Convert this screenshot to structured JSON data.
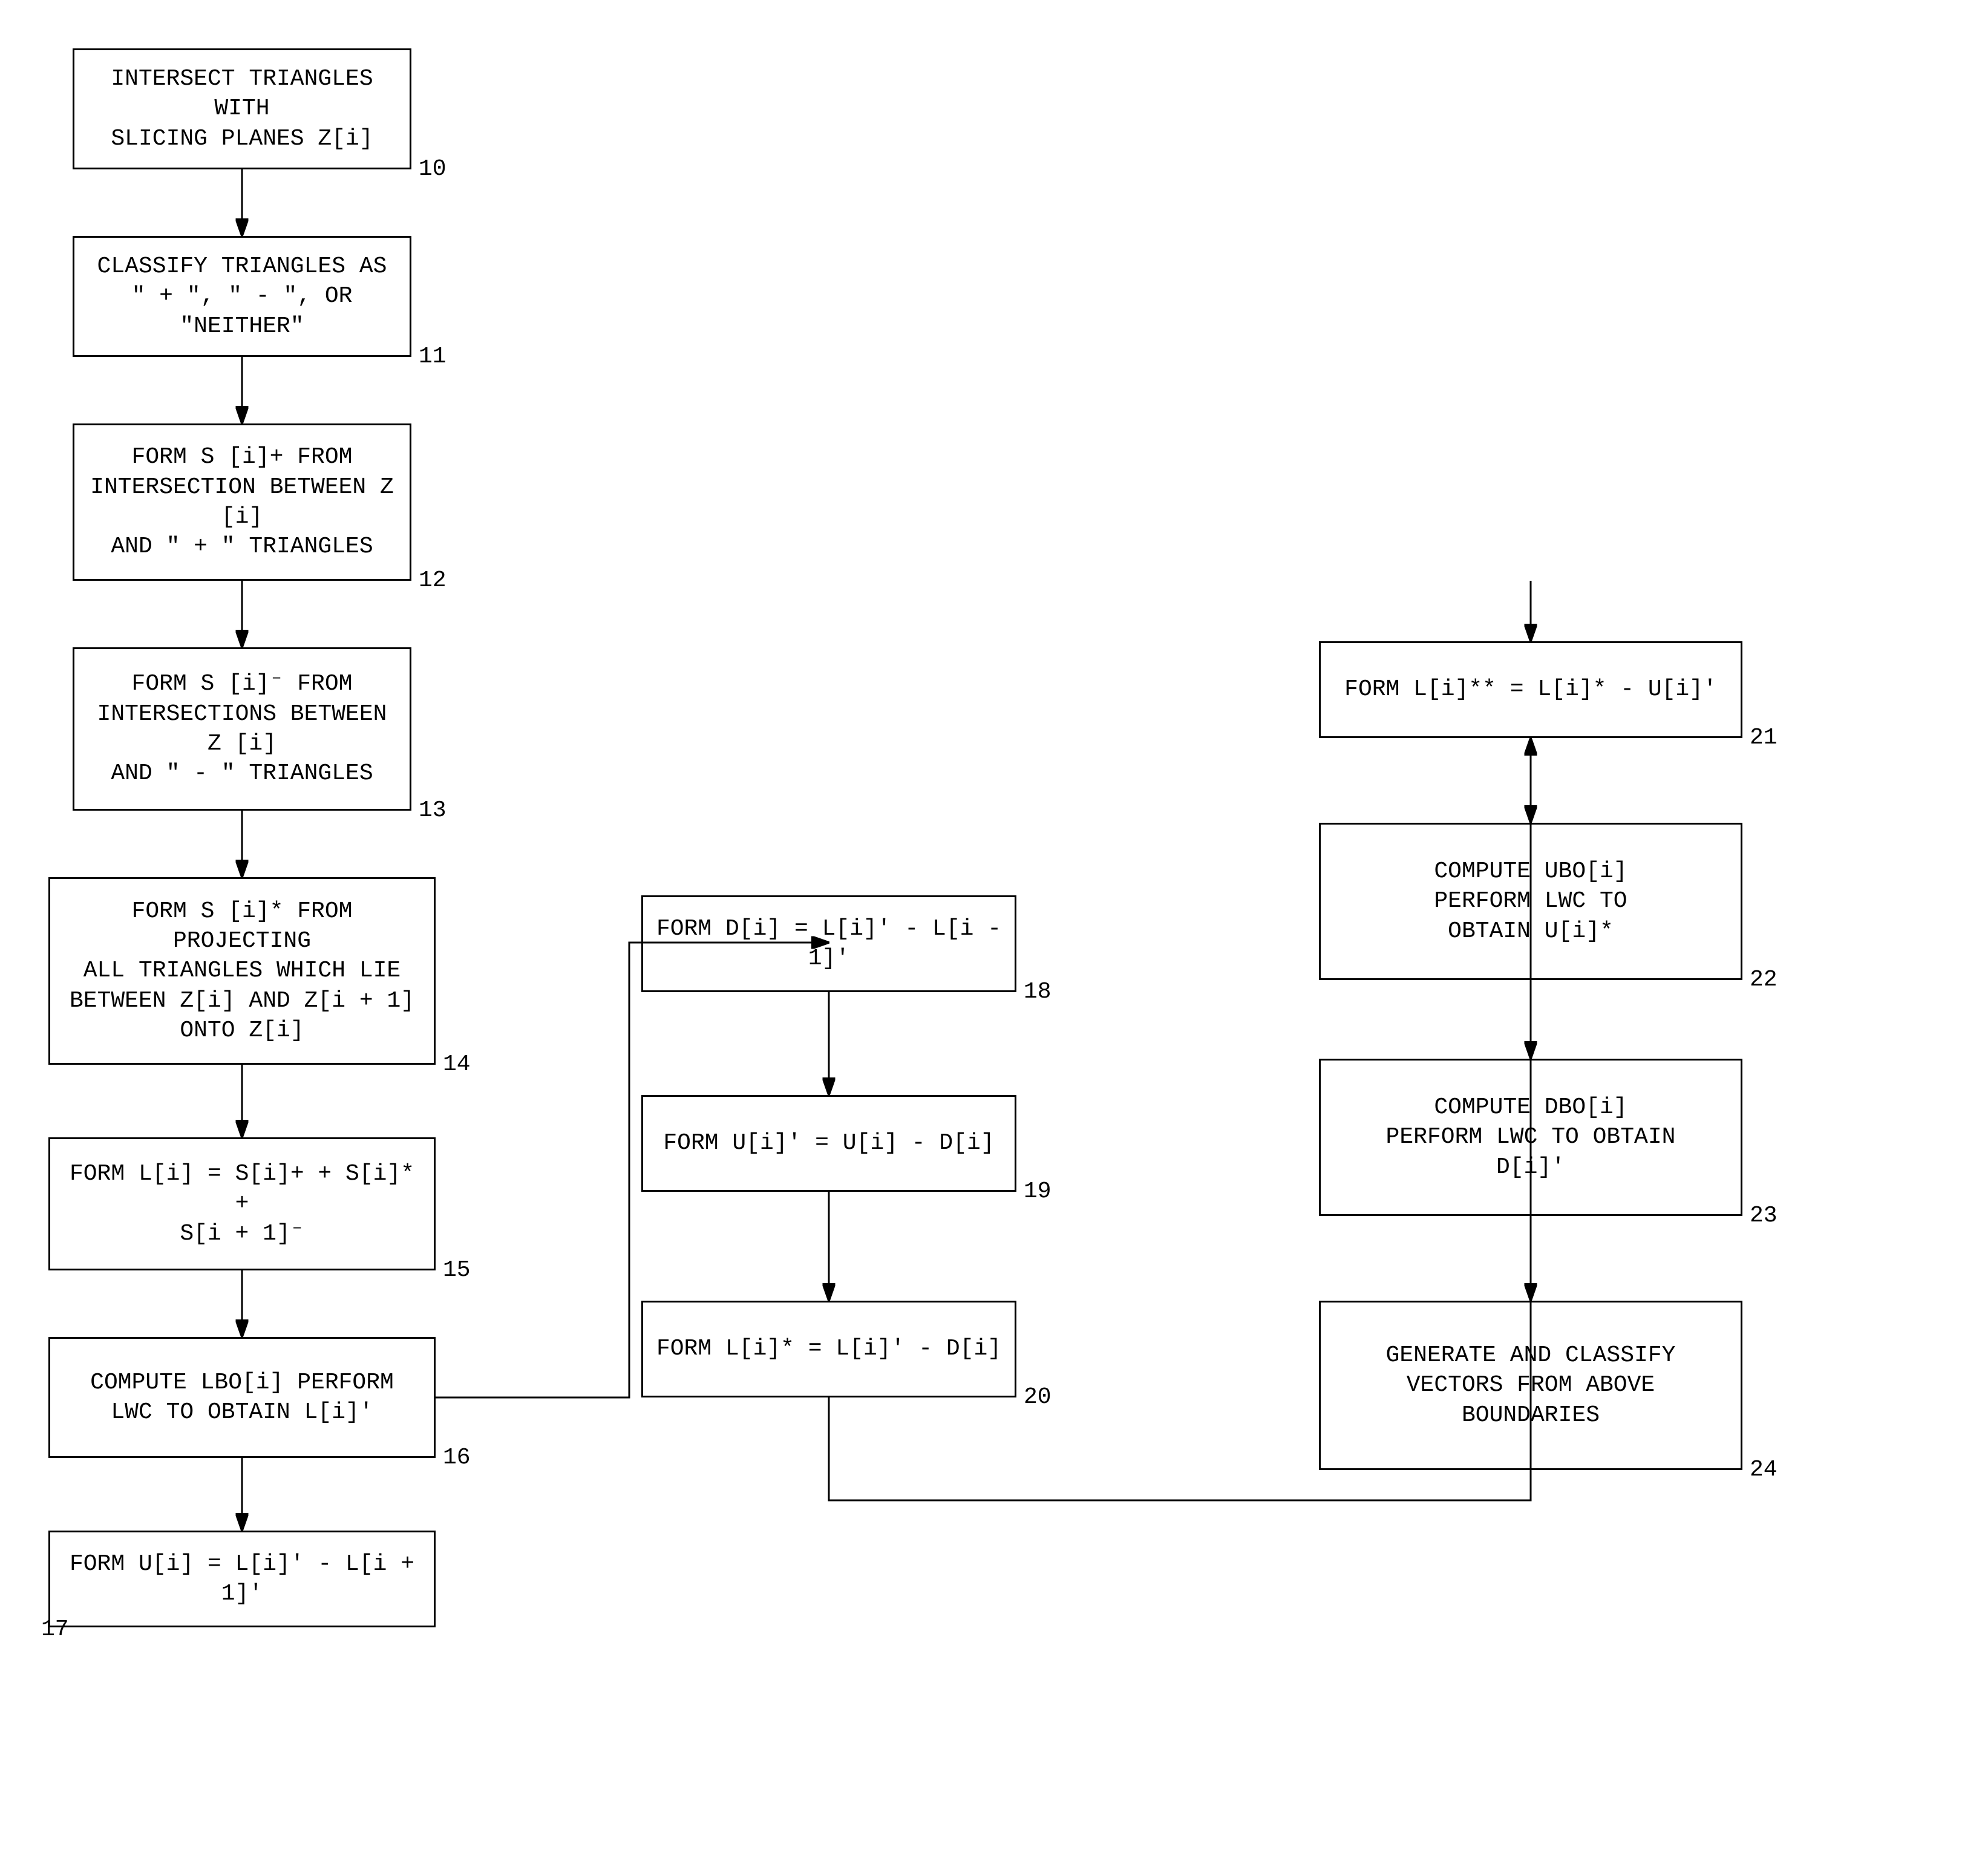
{
  "boxes": {
    "b10": {
      "label": "INTERSECT TRIANGLES WITH\nSLICING PLANES Z[i]",
      "number": "10"
    },
    "b11": {
      "label": "CLASSIFY TRIANGLES AS\n\" + \", \" - \", OR \"NEITHER\"",
      "number": "11"
    },
    "b12": {
      "label": "FORM S [i]+ FROM\nINTERSECTION BETWEEN Z [i]\nAND \" + \" TRIANGLES",
      "number": "12"
    },
    "b13": {
      "label": "FORM S [i]⁻ FROM\nINTERSECTIONS BETWEEN Z [i]\nAND \" - \" TRIANGLES",
      "number": "13"
    },
    "b14": {
      "label": "FORM S [i]* FROM PROJECTING\nALL TRIANGLES WHICH LIE\nBETWEEN Z[i] AND Z[i + 1]\nONTO Z[i]",
      "number": "14"
    },
    "b15": {
      "label": "FORM L[i] = S[i]+ + S[i]* +\nS[i + 1]⁻",
      "number": "15"
    },
    "b16": {
      "label": "COMPUTE LBO[i] PERFORM\nLWC TO OBTAIN L[i]'",
      "number": "16"
    },
    "b17": {
      "label": "FORM U[i] = L[i]' - L[i + 1]'",
      "number": "17"
    },
    "b18": {
      "label": "FORM D[i] = L[i]' - L[i - 1]'",
      "number": "18"
    },
    "b19": {
      "label": "FORM U[i]' = U[i] - D[i]",
      "number": "19"
    },
    "b20": {
      "label": "FORM L[i]* = L[i]' - D[i]",
      "number": "20"
    },
    "b21": {
      "label": "FORM L[i]** = L[i]* - U[i]'",
      "number": "21"
    },
    "b22": {
      "label": "COMPUTE UBO[i]\nPERFORM LWC TO\nOBTAIN U[i]*",
      "number": "22"
    },
    "b23": {
      "label": "COMPUTE DBO[i]\nPERFORM LWC TO OBTAIN\nD[i]'",
      "number": "23"
    },
    "b24": {
      "label": "GENERATE AND CLASSIFY\nVECTORS FROM ABOVE\nBOUNDARIES",
      "number": "24"
    }
  }
}
